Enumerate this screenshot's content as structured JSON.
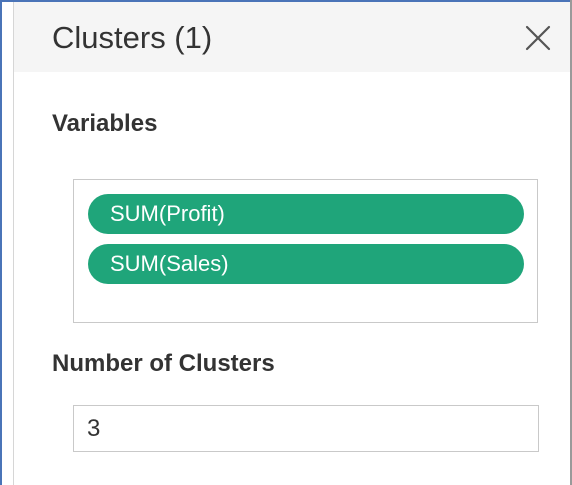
{
  "dialog": {
    "title": "Clusters (1)",
    "close_icon": "close-icon"
  },
  "variables": {
    "label": "Variables",
    "items": [
      {
        "label": "SUM(Profit)"
      },
      {
        "label": "SUM(Sales)"
      }
    ],
    "pill_color": "#1fa57a"
  },
  "number_of_clusters": {
    "label": "Number of Clusters",
    "value": "3"
  },
  "colors": {
    "accent_border": "#4a74b8",
    "header_bg": "#f5f5f5",
    "text": "#333333"
  }
}
